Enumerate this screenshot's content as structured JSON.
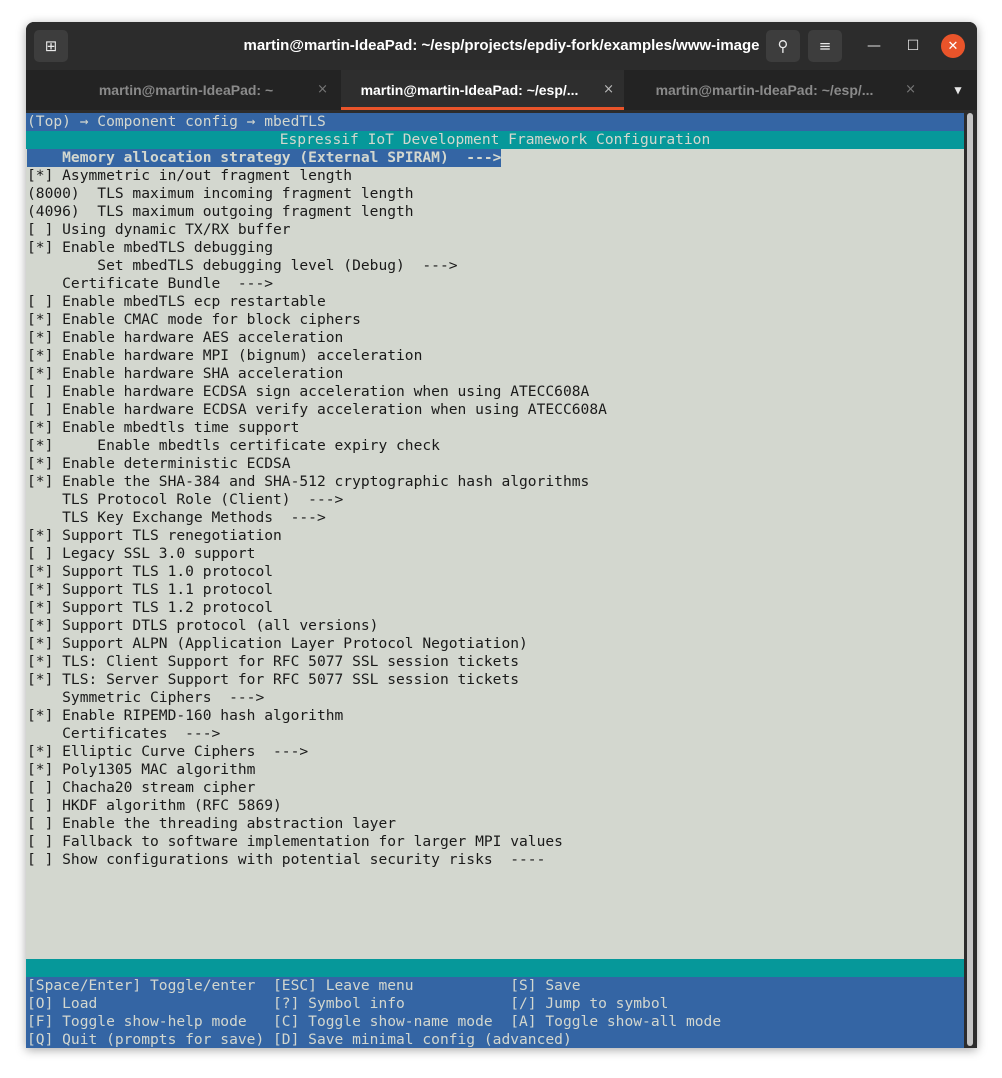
{
  "window": {
    "title": "martin@martin-IdeaPad: ~/esp/projects/epdiy-fork/examples/www-image",
    "icons": {
      "new_tab": "new-tab-icon",
      "search": "search-icon",
      "menu": "hamburger-menu-icon",
      "minimize": "minimize-icon",
      "maximize": "maximize-icon",
      "close": "close-icon"
    },
    "glyphs": {
      "new_tab": "⊞",
      "search": "⚲",
      "menu": "≡",
      "minimize": "—",
      "maximize": "☐",
      "close": "✕",
      "tab_close": "×",
      "dropdown": "▼"
    }
  },
  "tabs": [
    {
      "label": "martin@martin-IdeaPad: ~",
      "active": false
    },
    {
      "label": "martin@martin-IdeaPad: ~/esp/...",
      "active": true
    },
    {
      "label": "martin@martin-IdeaPad: ~/esp/...",
      "active": false
    }
  ],
  "menuconfig": {
    "breadcrumb": "(Top) → Component config → mbedTLS",
    "header": "Espressif IoT Development Framework Configuration",
    "items": [
      "    Memory allocation strategy (External SPIRAM)  --->",
      "[*] Asymmetric in/out fragment length",
      "(8000)  TLS maximum incoming fragment length",
      "(4096)  TLS maximum outgoing fragment length",
      "[ ] Using dynamic TX/RX buffer",
      "[*] Enable mbedTLS debugging",
      "        Set mbedTLS debugging level (Debug)  --->",
      "    Certificate Bundle  --->",
      "[ ] Enable mbedTLS ecp restartable",
      "[*] Enable CMAC mode for block ciphers",
      "[*] Enable hardware AES acceleration",
      "[*] Enable hardware MPI (bignum) acceleration",
      "[*] Enable hardware SHA acceleration",
      "[ ] Enable hardware ECDSA sign acceleration when using ATECC608A",
      "[ ] Enable hardware ECDSA verify acceleration when using ATECC608A",
      "[*] Enable mbedtls time support",
      "[*]     Enable mbedtls certificate expiry check",
      "[*] Enable deterministic ECDSA",
      "[*] Enable the SHA-384 and SHA-512 cryptographic hash algorithms",
      "    TLS Protocol Role (Client)  --->",
      "    TLS Key Exchange Methods  --->",
      "[*] Support TLS renegotiation",
      "[ ] Legacy SSL 3.0 support",
      "[*] Support TLS 1.0 protocol",
      "[*] Support TLS 1.1 protocol",
      "[*] Support TLS 1.2 protocol",
      "[*] Support DTLS protocol (all versions)",
      "[*] Support ALPN (Application Layer Protocol Negotiation)",
      "[*] TLS: Client Support for RFC 5077 SSL session tickets",
      "[*] TLS: Server Support for RFC 5077 SSL session tickets",
      "    Symmetric Ciphers  --->",
      "[*] Enable RIPEMD-160 hash algorithm",
      "    Certificates  --->",
      "[*] Elliptic Curve Ciphers  --->",
      "[*] Poly1305 MAC algorithm",
      "[ ] Chacha20 stream cipher",
      "[ ] HKDF algorithm (RFC 5869)",
      "[ ] Enable the threading abstraction layer",
      "[ ] Fallback to software implementation for larger MPI values",
      "[ ] Show configurations with potential security risks  ----"
    ],
    "help_lines": [
      "[Space/Enter] Toggle/enter  [ESC] Leave menu           [S] Save",
      "[O] Load                    [?] Symbol info            [/] Jump to symbol",
      "[F] Toggle show-help mode   [C] Toggle show-name mode  [A] Toggle show-all mode",
      "[Q] Quit (prompts for save) [D] Save minimal config (advanced)"
    ]
  },
  "colors": {
    "terminal_bg": "#d3d7cf",
    "menu_blue": "#3465a4",
    "header_teal": "#06989a",
    "accent_orange": "#e9542a",
    "titlebar": "#2c2c2c"
  }
}
